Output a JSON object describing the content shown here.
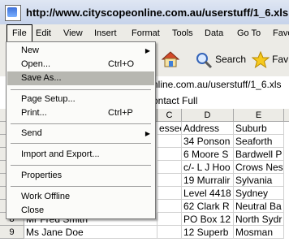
{
  "window": {
    "title": "http://www.cityscopeonline.com.au/userstuff/1_6.xls"
  },
  "menubar": {
    "items": [
      "File",
      "Edit",
      "View",
      "Insert",
      "Format",
      "Tools",
      "Data",
      "Go To",
      "Favo"
    ]
  },
  "toolbar": {
    "search_label": "Search",
    "favorites_label": "Fav"
  },
  "address": {
    "value": "nline.com.au/userstuff/1_6.xls"
  },
  "formula": {
    "value": "ontact Full"
  },
  "file_menu": {
    "items": [
      {
        "label": "New",
        "shortcut": "",
        "submenu": true
      },
      {
        "label": "Open...",
        "shortcut": "Ctrl+O",
        "submenu": false
      },
      {
        "label": "Save As...",
        "shortcut": "",
        "submenu": false
      },
      {
        "label": "Page Setup...",
        "shortcut": "",
        "submenu": false
      },
      {
        "label": "Print...",
        "shortcut": "Ctrl+P",
        "submenu": false
      },
      {
        "label": "Send",
        "shortcut": "",
        "submenu": true
      },
      {
        "label": "Import and Export...",
        "shortcut": "",
        "submenu": false
      },
      {
        "label": "Properties",
        "shortcut": "",
        "submenu": false
      },
      {
        "label": "Work Offline",
        "shortcut": "",
        "submenu": false
      },
      {
        "label": "Close",
        "shortcut": "",
        "submenu": false
      }
    ]
  },
  "sheet": {
    "columns": [
      "C",
      "D",
      "E"
    ],
    "rows": [
      {
        "num": "",
        "c": "essee",
        "d": "Address",
        "e": "Suburb"
      },
      {
        "num": "",
        "c": "",
        "d": "34 Ponson",
        "e": "Seaforth"
      },
      {
        "num": "",
        "c": "",
        "d": "6 Moore S",
        "e": "Bardwell P"
      },
      {
        "num": "",
        "c": "",
        "d": "c/- L J Hoo",
        "e": "Crows Nest"
      },
      {
        "num": "",
        "c": "",
        "d": "19 Murralir",
        "e": "Sylvania"
      },
      {
        "num": "",
        "c": "",
        "d": "Level 4418",
        "e": "Sydney"
      },
      {
        "num": "",
        "c": "",
        "d": "62 Clark R",
        "e": "Neutral Ba"
      },
      {
        "num": "8",
        "b": "Mr Fred Smith",
        "c": "",
        "d": "PO Box 12",
        "e": "North Sydr"
      },
      {
        "num": "9",
        "b": "Ms Jane Doe",
        "c": "",
        "d": "12 Superb",
        "e": "Mosman"
      }
    ]
  }
}
